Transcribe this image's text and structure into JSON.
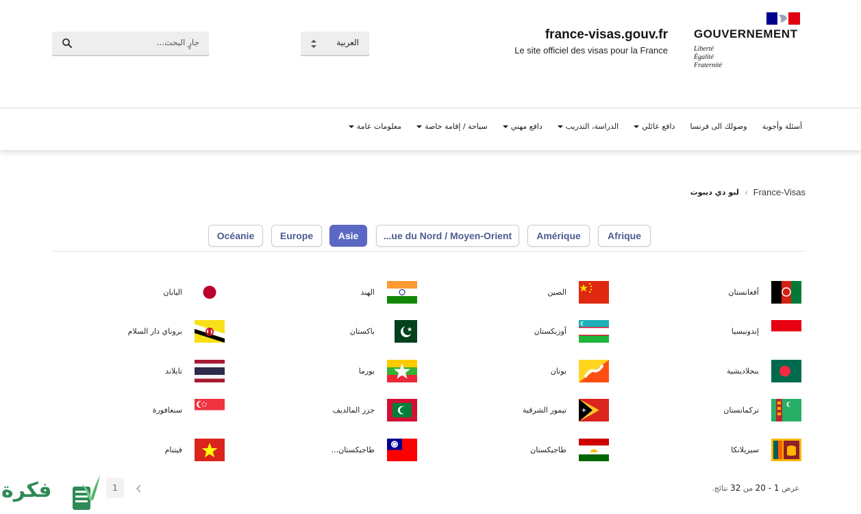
{
  "header": {
    "search_placeholder": "جارٍ البحث...",
    "language": "العربية",
    "site_title": "france-visas.gouv.fr",
    "site_tagline": "Le site officiel des visas pour la France",
    "gov_word": "GOUVERNEMENT",
    "motto": [
      "Liberté",
      "Égalité",
      "Fraternité"
    ]
  },
  "nav": {
    "items": [
      {
        "label": "معلومات عامة",
        "dropdown": true
      },
      {
        "label": "سياحة / إقامة خاصة",
        "dropdown": true
      },
      {
        "label": "دافع مهني",
        "dropdown": true
      },
      {
        "label": "الدراسة، التدريب",
        "dropdown": true
      },
      {
        "label": "دافع عائلي",
        "dropdown": true
      },
      {
        "label": "وصولك الى فرنسا",
        "dropdown": false
      },
      {
        "label": "أسئلة وأجوبة",
        "dropdown": false
      }
    ]
  },
  "breadcrumb": {
    "root": "France-Visas",
    "current": "لبو دي ديبوت"
  },
  "tabs": [
    {
      "label": "Afrique",
      "active": false
    },
    {
      "label": "Amérique",
      "active": false
    },
    {
      "label": "...ue du Nord / Moyen-Orient",
      "active": false
    },
    {
      "label": "Asie",
      "active": true
    },
    {
      "label": "Europe",
      "active": false
    },
    {
      "label": "Océanie",
      "active": false
    }
  ],
  "countries": [
    {
      "name": "أفغانستان",
      "flag": "afghanistan"
    },
    {
      "name": "الصين",
      "flag": "china"
    },
    {
      "name": "الهند",
      "flag": "india"
    },
    {
      "name": "اليابان",
      "flag": "japan"
    },
    {
      "name": "إندونيسيا",
      "flag": "indonesia"
    },
    {
      "name": "أوزبكستان",
      "flag": "uzbekistan"
    },
    {
      "name": "باكستان",
      "flag": "pakistan"
    },
    {
      "name": "بروناي دار السلام",
      "flag": "brunei"
    },
    {
      "name": "بنجلاديشية",
      "flag": "bangladesh"
    },
    {
      "name": "بوتان",
      "flag": "bhutan"
    },
    {
      "name": "بورما",
      "flag": "myanmar"
    },
    {
      "name": "تايلاند",
      "flag": "thailand"
    },
    {
      "name": "تركمانستان",
      "flag": "turkmenistan"
    },
    {
      "name": "تيمور الشرقية",
      "flag": "timor-leste"
    },
    {
      "name": "جزر المالديف",
      "flag": "maldives"
    },
    {
      "name": "سنغافورة",
      "flag": "singapore"
    },
    {
      "name": "سيريلانكا",
      "flag": "sri-lanka"
    },
    {
      "name": "طاجيكستان",
      "flag": "tajikistan"
    },
    {
      "name": "طاجيكستان...",
      "flag": "taiwan"
    },
    {
      "name": "فيتنام",
      "flag": "vietnam"
    }
  ],
  "pagination": {
    "results_prefix": "عرض",
    "range": "1 - 20",
    "results_middle": "من",
    "total": "32",
    "results_suffix": "نتائج.",
    "current_page": "1"
  },
  "watermark": {
    "text": "فكرة"
  },
  "colors": {
    "accent": "#5a68c4",
    "tab_text": "#4d5a8f",
    "watermark": "#2e8b57"
  }
}
